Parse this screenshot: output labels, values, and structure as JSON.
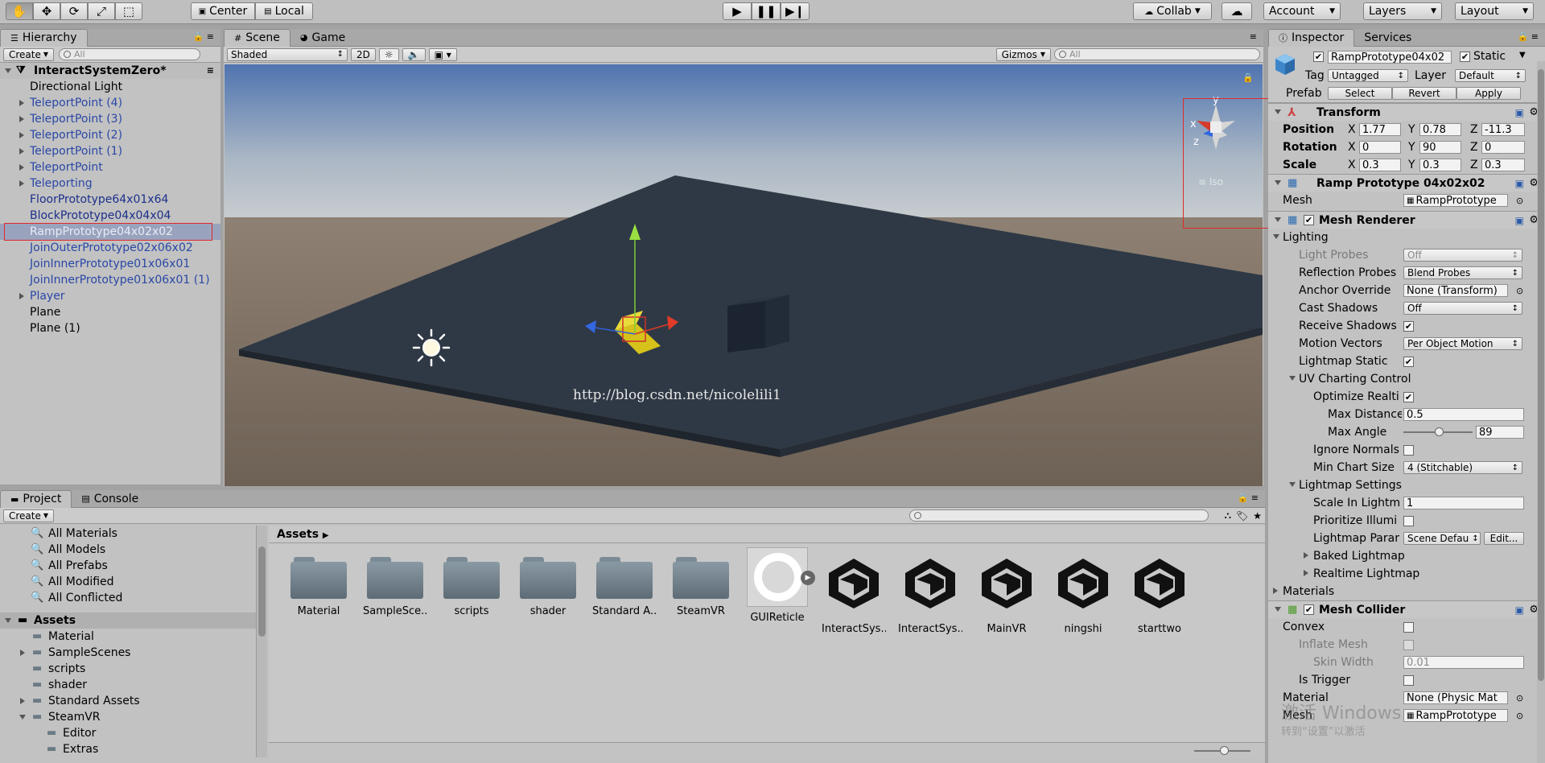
{
  "toolbar": {
    "pivot_center": "Center",
    "pivot_local": "Local",
    "collab": "Collab",
    "account": "Account",
    "layers": "Layers",
    "layout": "Layout"
  },
  "hierarchy": {
    "tab": "Hierarchy",
    "create": "Create",
    "search_placeholder": "All",
    "scene": "InteractSystemZero*",
    "items": [
      {
        "label": "Directional Light"
      },
      {
        "label": "TeleportPoint (4)"
      },
      {
        "label": "TeleportPoint (3)"
      },
      {
        "label": "TeleportPoint (2)"
      },
      {
        "label": "TeleportPoint (1)"
      },
      {
        "label": "TeleportPoint"
      },
      {
        "label": "Teleporting"
      },
      {
        "label": "FloorPrototype64x01x64"
      },
      {
        "label": "BlockPrototype04x04x04"
      },
      {
        "label": "RampPrototype04x02x02"
      },
      {
        "label": "JoinOuterPrototype02x06x02"
      },
      {
        "label": "JoinInnerPrototype01x06x01"
      },
      {
        "label": "JoinInnerPrototype01x06x01 (1)"
      },
      {
        "label": "Player"
      },
      {
        "label": "Plane"
      },
      {
        "label": "Plane (1)"
      }
    ]
  },
  "scene": {
    "tab_scene": "Scene",
    "tab_game": "Game",
    "shading": "Shaded",
    "mode_2d": "2D",
    "gizmos": "Gizmos",
    "search_placeholder": "All",
    "persp_label": "≡ Iso",
    "watermark": "http://blog.csdn.net/nicolelili1",
    "axis_y": "y",
    "axis_x": "x",
    "axis_z": "z"
  },
  "project": {
    "tab_project": "Project",
    "tab_console": "Console",
    "create": "Create",
    "favorites": [
      "All Materials",
      "All Models",
      "All Prefabs",
      "All Modified",
      "All Conflicted"
    ],
    "assets_root": "Assets",
    "folders": [
      "Material",
      "SampleScenes",
      "scripts",
      "shader",
      "Standard Assets",
      "SteamVR",
      "Editor",
      "Extras"
    ],
    "breadcrumb": "Assets",
    "grid": [
      "Material",
      "SampleSce...",
      "scripts",
      "shader",
      "Standard A...",
      "SteamVR",
      "GUIReticle",
      "InteractSys...",
      "InteractSys...",
      "MainVR",
      "ningshi",
      "starttwo"
    ]
  },
  "inspector": {
    "tab_inspector": "Inspector",
    "tab_services": "Services",
    "object_name": "RampPrototype04x02",
    "static_label": "Static",
    "tag_label": "Tag",
    "tag_value": "Untagged",
    "layer_label": "Layer",
    "layer_value": "Default",
    "prefab_label": "Prefab",
    "prefab_select": "Select",
    "prefab_revert": "Revert",
    "prefab_apply": "Apply",
    "transform": {
      "title": "Transform",
      "position_label": "Position",
      "pos_x": "1.77",
      "pos_y": "0.78",
      "pos_z": "-11.3",
      "rotation_label": "Rotation",
      "rot_x": "0",
      "rot_y": "90",
      "rot_z": "0",
      "scale_label": "Scale",
      "scl_x": "0.3",
      "scl_y": "0.3",
      "scl_z": "0.3",
      "x": "X",
      "y": "Y",
      "z": "Z"
    },
    "mesh_filter": {
      "title": "Ramp Prototype 04x02x02",
      "mesh_label": "Mesh",
      "mesh_value": "RampPrototype"
    },
    "mesh_renderer": {
      "title": "Mesh Renderer",
      "lighting": "Lighting",
      "light_probes": "Light Probes",
      "light_probes_value": "Off",
      "reflection_probes": "Reflection Probes",
      "reflection_probes_value": "Blend Probes",
      "anchor_override": "Anchor Override",
      "anchor_override_value": "None (Transform)",
      "cast_shadows": "Cast Shadows",
      "cast_shadows_value": "Off",
      "receive_shadows": "Receive Shadows",
      "motion_vectors": "Motion Vectors",
      "motion_vectors_value": "Per Object Motion",
      "lightmap_static": "Lightmap Static",
      "uv_charting": "UV Charting Control",
      "optimize": "Optimize Realti",
      "max_distance": "Max Distance",
      "max_distance_value": "0.5",
      "max_angle": "Max Angle",
      "max_angle_value": "89",
      "max_angle_fraction": 0.49,
      "ignore_normals": "Ignore Normals",
      "min_chart_size": "Min Chart Size",
      "min_chart_size_value": "4 (Stitchable)",
      "lightmap_settings": "Lightmap Settings",
      "scale_in_lightmap": "Scale In Lightm",
      "scale_in_lightmap_value": "1",
      "prioritize": "Prioritize Illumi",
      "lightmap_params": "Lightmap Parar",
      "lightmap_params_value": "Scene Defau",
      "edit": "Edit...",
      "baked_lightmap": "Baked Lightmap",
      "realtime_lightmap": "Realtime Lightmap",
      "materials": "Materials"
    },
    "mesh_collider": {
      "title": "Mesh Collider",
      "convex": "Convex",
      "inflate_mesh": "Inflate Mesh",
      "skin_width": "Skin Width",
      "skin_width_value": "0.01",
      "is_trigger": "Is Trigger",
      "material": "Material",
      "material_value": "None (Physic Mat",
      "mesh": "Mesh",
      "mesh_value": "RampPrototype"
    },
    "activate_watermark": "激活 Windows",
    "activate_watermark2": "转到“设置”以激活"
  },
  "colors": {
    "selection_outline": "#e02a2a",
    "prefab_blue": "#2a48a6",
    "sky_top": "#5a7fb8",
    "ground": "#75675b",
    "plane": "#2f3945"
  }
}
